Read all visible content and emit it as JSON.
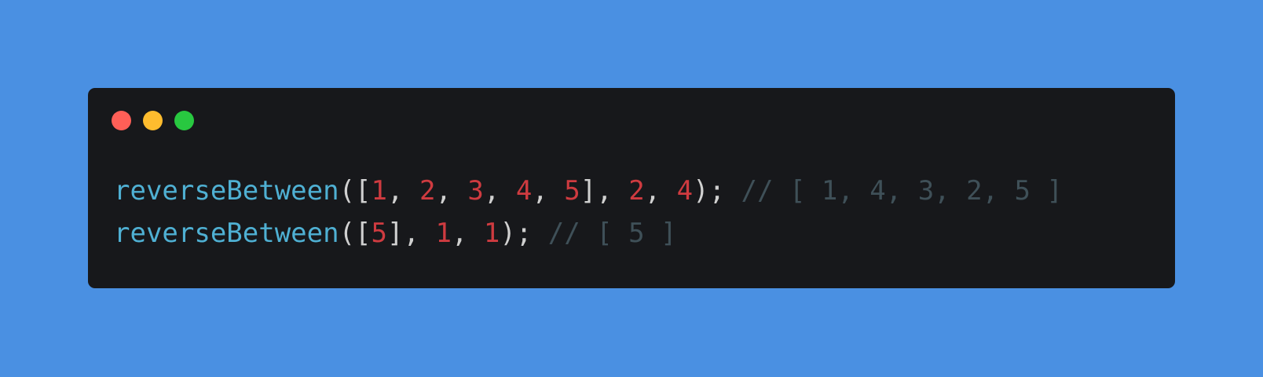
{
  "colors": {
    "background": "#4a90e2",
    "window": "#17181b",
    "close": "#ff5f57",
    "minimize": "#febc2e",
    "maximize": "#28c840",
    "function": "#4fb0d3",
    "number": "#cf3b40",
    "punctuation": "#d0d0d0",
    "comment": "#3f5058"
  },
  "window_controls": {
    "close_icon": "red-circle",
    "minimize_icon": "yellow-circle",
    "maximize_icon": "green-circle"
  },
  "code": {
    "lines": [
      {
        "tokens": [
          {
            "text": "reverseBetween",
            "type": "fn"
          },
          {
            "text": "([",
            "type": "punc"
          },
          {
            "text": "1",
            "type": "num"
          },
          {
            "text": ", ",
            "type": "punc"
          },
          {
            "text": "2",
            "type": "num"
          },
          {
            "text": ", ",
            "type": "punc"
          },
          {
            "text": "3",
            "type": "num"
          },
          {
            "text": ", ",
            "type": "punc"
          },
          {
            "text": "4",
            "type": "num"
          },
          {
            "text": ", ",
            "type": "punc"
          },
          {
            "text": "5",
            "type": "num"
          },
          {
            "text": "], ",
            "type": "punc"
          },
          {
            "text": "2",
            "type": "num"
          },
          {
            "text": ", ",
            "type": "punc"
          },
          {
            "text": "4",
            "type": "num"
          },
          {
            "text": "); ",
            "type": "punc"
          },
          {
            "text": "// [ 1, 4, 3, 2, 5 ]",
            "type": "comment"
          }
        ]
      },
      {
        "tokens": [
          {
            "text": "reverseBetween",
            "type": "fn"
          },
          {
            "text": "([",
            "type": "punc"
          },
          {
            "text": "5",
            "type": "num"
          },
          {
            "text": "], ",
            "type": "punc"
          },
          {
            "text": "1",
            "type": "num"
          },
          {
            "text": ", ",
            "type": "punc"
          },
          {
            "text": "1",
            "type": "num"
          },
          {
            "text": "); ",
            "type": "punc"
          },
          {
            "text": "// [ 5 ]",
            "type": "comment"
          }
        ]
      }
    ]
  }
}
